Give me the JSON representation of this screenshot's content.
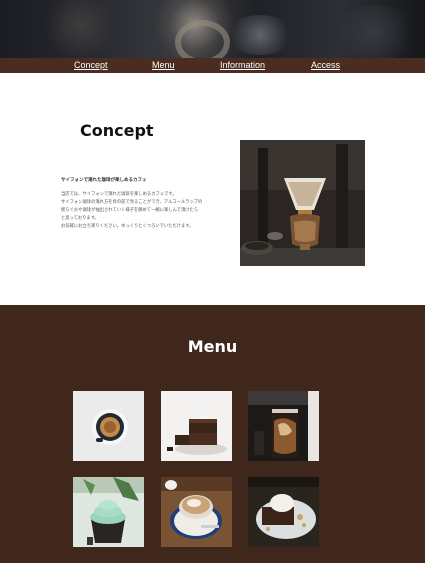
{
  "nav": {
    "items": [
      {
        "label": "Concept"
      },
      {
        "label": "Menu"
      },
      {
        "label": "Information"
      },
      {
        "label": "Access"
      }
    ]
  },
  "concept": {
    "title": "Concept",
    "subtitle": "サイフォンで淹れた珈琲が楽しめるカフェ",
    "body": [
      "当店では、サイフォンで淹れた珈琲を楽しめるカフェです。",
      "サイフォン珈琲の淹れ方を目の前で見ることができ、アルコールランプの",
      "揺らぐ炎や珈琲が抽出されていく様子を眺めて一緒に楽しんで頂けたら",
      "と思っております。",
      "お気軽にお立ち寄りください。ゆっくりとくつろいでいただけます。"
    ]
  },
  "menu": {
    "title": "Menu",
    "items": [
      {
        "image": "espresso-cup-image"
      },
      {
        "image": "brownie-image"
      },
      {
        "image": "iced-coffee-image"
      },
      {
        "image": "cupcake-image"
      },
      {
        "image": "latte-image"
      },
      {
        "image": "brownie-ice-cream-image"
      }
    ]
  },
  "colors": {
    "nav_bg": "#4a2c20",
    "menu_bg": "#3f271c",
    "white": "#ffffff"
  }
}
